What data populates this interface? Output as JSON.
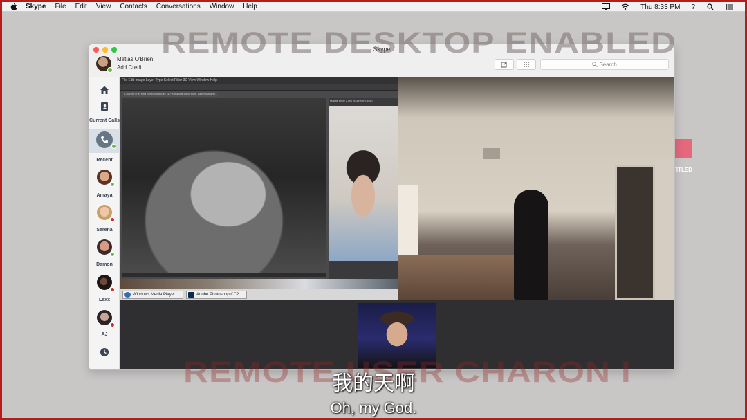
{
  "menubar": {
    "app_name": "Skype",
    "items": [
      "File",
      "Edit",
      "View",
      "Contacts",
      "Conversations",
      "Window",
      "Help"
    ],
    "clock": "Thu 8:33 PM",
    "help_glyph": "?"
  },
  "desktop": {
    "file_label": "TITLED"
  },
  "overlays": {
    "top_banner": "REMOTE DESKTOP ENABLED",
    "bottom_banner": "REMOTE USER CHARON I"
  },
  "window": {
    "title": "Skype",
    "profile": {
      "name": "Matias O'Brien",
      "credit": "Add Credit",
      "status": "online"
    },
    "search_placeholder": "Search",
    "sidebar": {
      "current_calls_label": "Current Calls",
      "recent_label": "Recent",
      "contacts": [
        {
          "name": "Amaya",
          "status": "online",
          "color": "#b8826a"
        },
        {
          "name": "Serena",
          "status": "busy",
          "color": "#d8a98f"
        },
        {
          "name": "Damon",
          "status": "online",
          "color": "#c98c7a"
        },
        {
          "name": "Lexx",
          "status": "busy",
          "color": "#3a2a24"
        },
        {
          "name": "AJ",
          "status": "busy",
          "color": "#5a4a46"
        }
      ]
    },
    "screen_share": {
      "app_menu": "File  Edit  Image  Layer  Type  Select  Filter  3D  View  Window  Help",
      "doc_tab": "Charon(IV)in lima bedroom.jpg @ 117% (Background copy, Layer Mask/8)",
      "side_tab": "Matias bride 2.jpg @ 38% (RGB/8)",
      "taskbar": [
        {
          "label": "Windows Media Player"
        },
        {
          "label": "Adobe Photoshop CC2..."
        }
      ]
    }
  },
  "subtitles": {
    "chinese": "我的天啊",
    "english": "Oh, my God."
  },
  "colors": {
    "frame": "#b41e1a",
    "online": "#6bbf3e",
    "busy": "#c82c2c",
    "desk_file": "#e4697d"
  }
}
